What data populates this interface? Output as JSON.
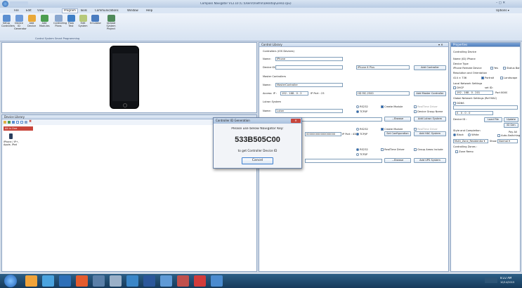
{
  "window": {
    "title": "Compass Navigator V12.10 (C:\\Users\\hrwfnn\\Desktop\\ZenD.cpu)",
    "controls": [
      "–",
      "▢",
      "✕"
    ]
  },
  "menu": {
    "items": [
      "File",
      "Edit",
      "View",
      "Program",
      "Tools",
      "Communications",
      "Window",
      "Help"
    ],
    "options": "Options ▾"
  },
  "ribbon": {
    "buttons": [
      "Setup Controllers",
      "Device ID Generator",
      "Add Device",
      "Add Modules",
      "Controlling Plans",
      "Flow Test",
      "Edit System",
      "Emulator",
      "Upload System Project"
    ],
    "group_label": "Control System Smart Programming",
    "icon_colors": [
      "#5b8fd1",
      "#6d9ad8",
      "#e9a93a",
      "#4c9e50",
      "#8aa7cf",
      "#3f7fc6",
      "#b7c97a",
      "#4a7cc0",
      "#4f8a5a"
    ]
  },
  "device_library": {
    "title": "Device Library",
    "filter": "All in One",
    "item": "iPhone / iP+, Apple, iPod",
    "toolbar_icons": [
      "folder-icon",
      "add-icon",
      "check-icon",
      "list-icon",
      "grid-icon",
      "image-icon",
      "delete-icon"
    ]
  },
  "control_library": {
    "title": "Control Library",
    "pin_icons": "▾ ✕",
    "controllers_section": "Controllers (iOS Devices)",
    "name_label": "Name:",
    "name_value": "iPhone",
    "device_id_label": "Device ID:",
    "device_model": "iPhone 6 Plus",
    "add_controller": "Add Controller",
    "master_section": "Master Controllers",
    "master_name_value": "MasterController",
    "access_label": "Access: IP :",
    "access_ip": "192 . 168 . 0 . 2",
    "ip_port_label": "IP Port : 23",
    "master_model": "HD MC-2500",
    "add_master": "Add Master Controller",
    "lutron_section": "Lutron System",
    "lutron_name_value": "Luton",
    "rs232": "RS232",
    "tcpip": "TCP/IP",
    "create_module": "Create Module",
    "realtime_driver": "RealTime Driver",
    "device_group_name": "Device Group Name",
    "browse": "...Browse",
    "add_lutron": "Add Lutron System",
    "zeros": "000000000000000000",
    "port_label": "IP Port : 4389",
    "set_configuration": "Set Configuration",
    "add_hac": "Add HAC System",
    "group_areas": "Group Areas Include",
    "add_ups": "Add UPS System"
  },
  "properties": {
    "title": "Properties",
    "controlling_device": "Controlling Device",
    "name_id": "Name (ID) iPhone",
    "device_type": "Device Type",
    "remote_device": "iPhone Remote Device",
    "yes": "Yes",
    "status_bar": "Status Bar",
    "resolution_header": "Resolution and Orientation",
    "resolution": "414 × 736",
    "portrait": "Portrait",
    "landscape": "Landscape",
    "network_header": "Local Network Settings",
    "dhcp": "DHCP",
    "set_id": "set ID:",
    "ip_line": "192 . 168 . 0 . 201",
    "port": "Port 8000",
    "global_header": "Global Network Settings (Ref MAC)",
    "ddns": "DDNS",
    "ip_zero": "0 . 0 . 0 . 0",
    "device_id_label": "Device ID :",
    "load_file": "Load File",
    "update": "Update",
    "id_gen": "ID Gen",
    "style_header": "Style and Completion",
    "black": "Black",
    "white": "White",
    "pay_all": "Pay All",
    "auto_switching": "Auto-Switching",
    "style_select": "Multi_Zone_Residentia ▾",
    "show": "Show",
    "normal": "Normal ▾",
    "controlling_zones": "Controlling Zones :",
    "zone_item": "Zone Remo"
  },
  "dialog": {
    "title": "Controller ID Generation",
    "prompt": "Please use below Navigator Key:",
    "key": "533B505C00",
    "hint": "to get Controller Device ID",
    "cancel": "Cancel",
    "close": "✕"
  },
  "status_bar": {
    "clock": "8:22 AM",
    "date": "10/14/2015"
  },
  "colors": {
    "accent": "#1f5fb5",
    "panel_border": "#8fa6c4",
    "dialog_title": "#c9d8ec",
    "taskbar": "#16395a",
    "close_red": "#c8453b"
  }
}
